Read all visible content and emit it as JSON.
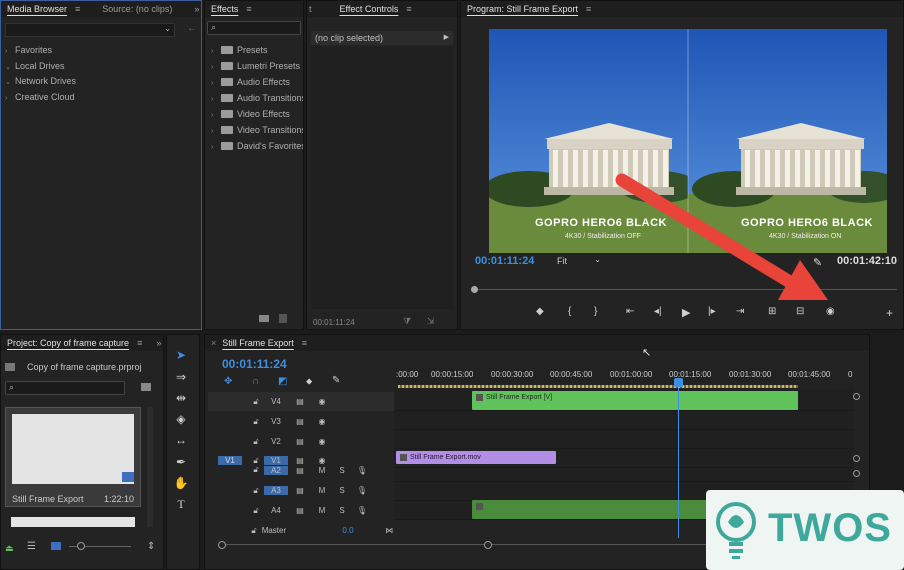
{
  "media_browser": {
    "tabs": [
      "Media Browser",
      "Source: (no clips)"
    ],
    "tree": [
      "Favorites",
      "Local Drives",
      "Network Drives",
      "Creative Cloud"
    ]
  },
  "effects": {
    "tab": "Effects",
    "search_placeholder": "",
    "items": [
      "Presets",
      "Lumetri Presets",
      "Audio Effects",
      "Audio Transitions",
      "Video Effects",
      "Video Transitions",
      "David's Favorites"
    ]
  },
  "effect_controls": {
    "tab": "Effect Controls",
    "clip_label": "(no clip selected)",
    "timecode": "00:01:11:24"
  },
  "program": {
    "tab": "Program: Still Frame Export",
    "left_caption": "GOPRO HERO6 BLACK",
    "left_sub": "4K30 / Stabilization OFF",
    "right_caption": "GOPRO HERO6 BLACK",
    "right_sub": "4K30 / Stabilization ON",
    "timecode": "00:01:11:24",
    "fit": "Fit",
    "duration": "00:01:42:10"
  },
  "project": {
    "tab": "Project: Copy of frame capture",
    "file": "Copy of frame capture.prproj",
    "thumb_name": "Still Frame Export",
    "thumb_duration": "1:22:10"
  },
  "timeline": {
    "tab": "Still Frame Export",
    "timecode": "00:01:11:24",
    "ruler": [
      ":00:00",
      "00:00:15:00",
      "00:00:30:00",
      "00:00:45:00",
      "00:01:00:00",
      "00:01:15:00",
      "00:01:30:00",
      "00:01:45:00",
      "0"
    ],
    "tracks": [
      {
        "name": "V4",
        "type": "video"
      },
      {
        "name": "V3",
        "type": "video"
      },
      {
        "name": "V2",
        "type": "video"
      },
      {
        "name": "V1",
        "type": "video",
        "src": "V1"
      },
      {
        "name": "A2",
        "type": "audio"
      },
      {
        "name": "A3",
        "type": "audio"
      },
      {
        "name": "A4",
        "type": "audio"
      }
    ],
    "master": "Master",
    "master_value": "0.0",
    "clips": {
      "v4_clip": "Still Frame Export [V]",
      "v1_clip": "Still Frame Export.mov"
    },
    "m_label": "M",
    "s_label": "S"
  },
  "watermark": {
    "text": "TWOS"
  },
  "colors": {
    "accent_blue": "#3f8fe0",
    "clip_green": "#5fc25a",
    "clip_purple": "#b38ee6",
    "arrow_red": "#e8443a"
  }
}
